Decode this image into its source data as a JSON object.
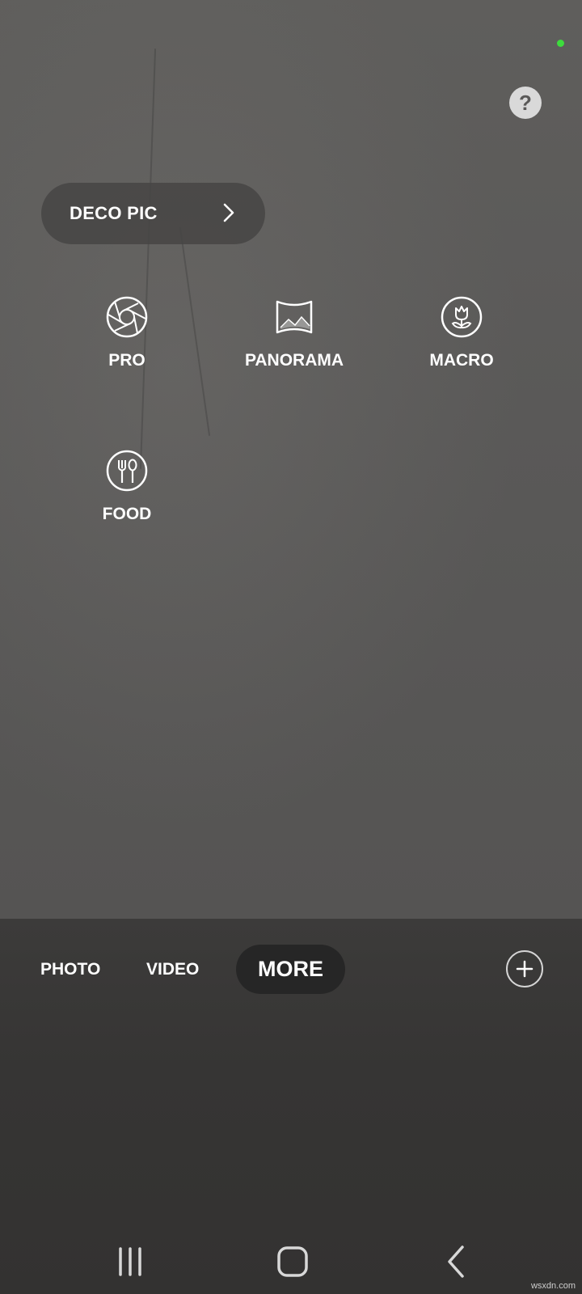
{
  "status": {
    "indicator_color": "#3ddc3d"
  },
  "help": {
    "label": "?"
  },
  "deco_pic": {
    "label": "DECO PIC"
  },
  "modes": [
    {
      "label": "PRO",
      "icon": "aperture-icon"
    },
    {
      "label": "PANORAMA",
      "icon": "panorama-icon"
    },
    {
      "label": "MACRO",
      "icon": "flower-icon"
    },
    {
      "label": "FOOD",
      "icon": "fork-spoon-icon"
    }
  ],
  "tabs": {
    "photo": "PHOTO",
    "video": "VIDEO",
    "more": "MORE",
    "selected": "MORE"
  },
  "watermark": "wsxdn.com",
  "colors": {
    "viewfinder_bg": "#5b5a58",
    "panel_bg": "#363534",
    "selected_pill": "#262626"
  }
}
